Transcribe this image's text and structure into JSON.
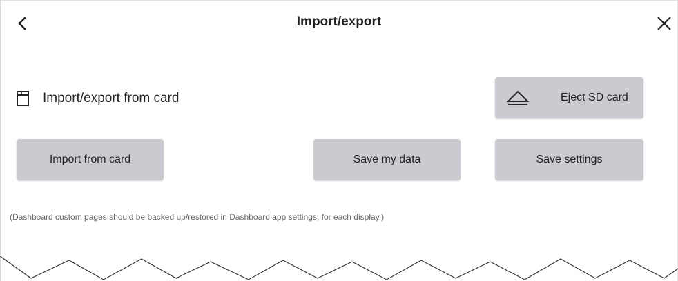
{
  "header": {
    "title": "Import/export",
    "back_icon": "chevron-left-icon",
    "close_icon": "close-icon"
  },
  "card_section": {
    "icon": "sd-card-icon",
    "label": "Import/export from card"
  },
  "buttons": {
    "eject_icon": "eject-icon",
    "eject_label": "Eject SD card",
    "import_label": "Import from card",
    "save_data_label": "Save my data",
    "save_settings_label": "Save settings"
  },
  "note": "(Dashboard custom pages should be backed up/restored in Dashboard app settings, for each display.)",
  "colors": {
    "button_bg": "#c9cbd0",
    "text": "#222222",
    "note_text": "#666666"
  }
}
